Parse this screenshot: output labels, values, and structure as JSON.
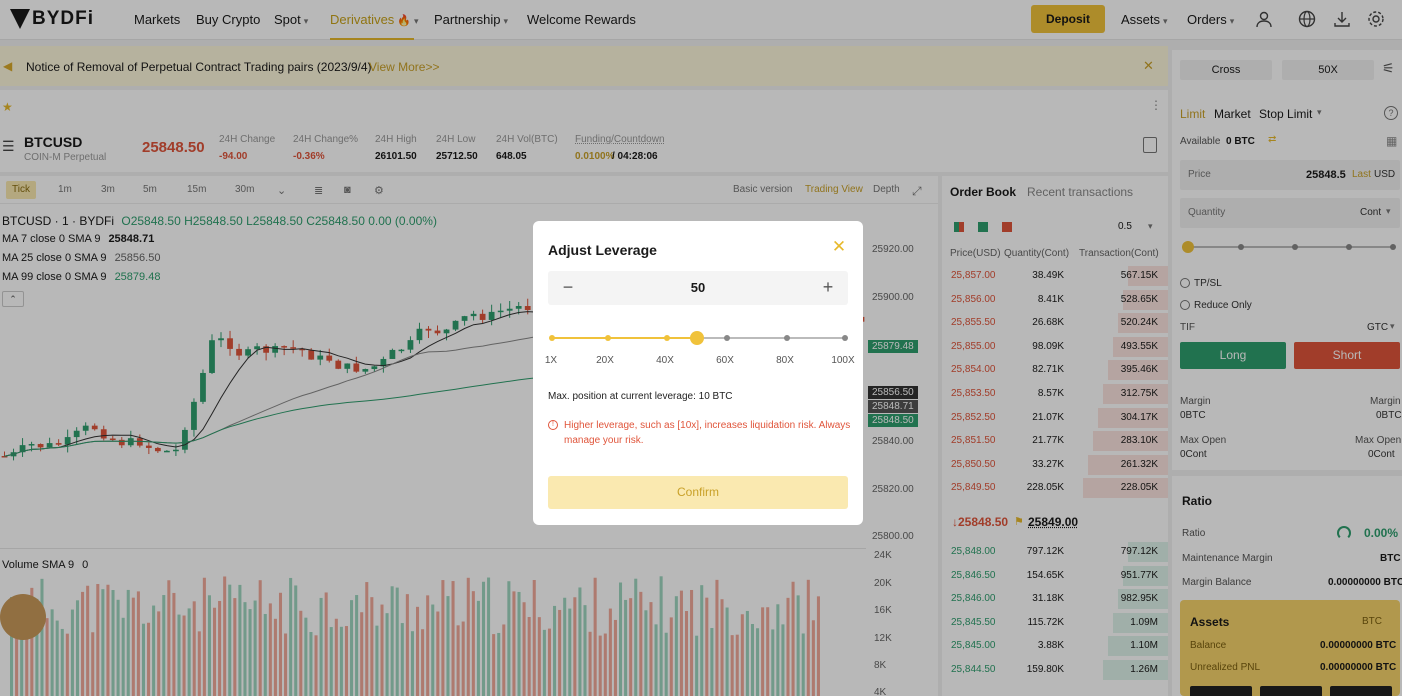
{
  "nav": {
    "logo": "BYDFi",
    "items": [
      "Markets",
      "Buy Crypto",
      "Spot",
      "Derivatives",
      "Partnership",
      "Welcome Rewards"
    ],
    "deposit": "Deposit",
    "assets": "Assets",
    "orders": "Orders"
  },
  "notice": {
    "text": "Notice of Removal of Perpetual Contract Trading pairs (2023/9/4)",
    "more": "View More>>"
  },
  "market": {
    "symbol": "BTCUSD",
    "sub": "COIN-M Perpetual",
    "price": "25848.50",
    "stats": [
      {
        "label": "24H Change",
        "value": "-94.00"
      },
      {
        "label": "24H Change%",
        "value": "-0.36%"
      },
      {
        "label": "24H High",
        "value": "26101.50"
      },
      {
        "label": "24H Low",
        "value": "25712.50"
      },
      {
        "label": "24H Vol(BTC)",
        "value": "648.05"
      }
    ],
    "funding_label": "Funding/Countdown",
    "funding_rate": "0.0100%",
    "countdown": "/ 04:28:06"
  },
  "chart": {
    "timeframes": [
      "Tick",
      "1m",
      "3m",
      "5m",
      "15m",
      "30m"
    ],
    "views": [
      "Basic version",
      "Trading View",
      "Depth"
    ],
    "ohlc": "BTCUSD · 1 · BYDFi",
    "ohlc_vals": "O25848.50 H25848.50 L25848.50 C25848.50 0.00 (0.00%)",
    "ma7": "MA 7 close 0 SMA 9",
    "ma7_val": "25848.71",
    "ma25": "MA 25 close 0 SMA 9",
    "ma25_val": "25856.50",
    "ma99": "MA 99 close 0 SMA 9",
    "ma99_val": "25879.48",
    "price_axis": [
      "25920.00",
      "25900.00",
      "25879.48",
      "25856.50",
      "25848.71",
      "25848.50",
      "25840.00",
      "25820.00",
      "25800.00"
    ],
    "volume_label": "Volume SMA 9",
    "volume_val": "0",
    "volume_axis": [
      "24K",
      "20K",
      "16K",
      "12K",
      "8K",
      "4K"
    ]
  },
  "orderbook": {
    "tabs": [
      "Order Book",
      "Recent transactions"
    ],
    "precision": "0.5",
    "headers": [
      "Price(USD)",
      "Quantity(Cont)",
      "Transaction(Cont)"
    ],
    "asks": [
      [
        "25,857.00",
        "38.49K",
        "567.15K"
      ],
      [
        "25,856.00",
        "8.41K",
        "528.65K"
      ],
      [
        "25,855.50",
        "26.68K",
        "520.24K"
      ],
      [
        "25,855.00",
        "98.09K",
        "493.55K"
      ],
      [
        "25,854.00",
        "82.71K",
        "395.46K"
      ],
      [
        "25,853.50",
        "8.57K",
        "312.75K"
      ],
      [
        "25,852.50",
        "21.07K",
        "304.17K"
      ],
      [
        "25,851.50",
        "21.77K",
        "283.10K"
      ],
      [
        "25,850.50",
        "33.27K",
        "261.32K"
      ],
      [
        "25,849.50",
        "228.05K",
        "228.05K"
      ]
    ],
    "last_price": "↓25848.50",
    "mark_price": "25849.00",
    "bids": [
      [
        "25,848.00",
        "797.12K",
        "797.12K"
      ],
      [
        "25,846.50",
        "154.65K",
        "951.77K"
      ],
      [
        "25,846.00",
        "31.18K",
        "982.95K"
      ],
      [
        "25,845.50",
        "115.72K",
        "1.09M"
      ],
      [
        "25,845.00",
        "3.88K",
        "1.10M"
      ],
      [
        "25,844.50",
        "159.80K",
        "1.26M"
      ]
    ]
  },
  "trade": {
    "margin_mode": "Cross",
    "leverage": "50X",
    "order_types": [
      "Limit",
      "Market",
      "Stop Limit"
    ],
    "available_label": "Available",
    "available_val": "0 BTC",
    "price_label": "Price",
    "price_val": "25848.5",
    "price_last": "Last",
    "price_unit": "USD",
    "qty_label": "Quantity",
    "qty_unit": "Cont",
    "tpsl": "TP/SL",
    "reduce_only": "Reduce Only",
    "tif": "TIF",
    "tif_val": "GTC",
    "long": "Long",
    "short": "Short",
    "margin_label": "Margin",
    "margin_val": "0BTC",
    "maxopen_label": "Max Open",
    "maxopen_val": "0Cont"
  },
  "ratio": {
    "title": "Ratio",
    "ratio_label": "Ratio",
    "ratio_val": "0.00%",
    "mm_label": "Maintenance Margin",
    "mm_val": "BTC",
    "mb_label": "Margin Balance",
    "mb_val": "0.00000000 BTC"
  },
  "assets": {
    "title": "Assets",
    "unit": "BTC",
    "balance_label": "Balance",
    "balance_val": "0.00000000 BTC",
    "pnl_label": "Unrealized PNL",
    "pnl_val": "0.00000000 BTC"
  },
  "modal": {
    "title": "Adjust Leverage",
    "value": "50",
    "ticks": [
      "1X",
      "20X",
      "40X",
      "60X",
      "80X",
      "100X"
    ],
    "max_position": "Max. position at current leverage: 10 BTC",
    "warning": "Higher leverage, such as [10x], increases liquidation risk. Always manage your risk.",
    "confirm": "Confirm"
  },
  "colors": {
    "accent": "#f0c23b",
    "up": "#2e9e6e",
    "down": "#e0553b"
  }
}
